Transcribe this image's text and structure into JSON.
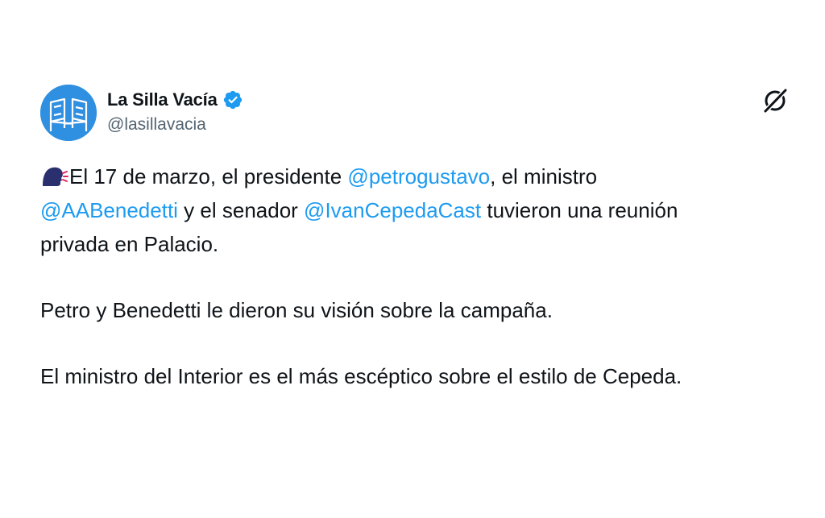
{
  "author": {
    "display_name": "La Silla Vacía",
    "handle": "@lasillavacia",
    "verified": true,
    "avatar_icon": "two-chairs-logo",
    "avatar_color": "#2f8fe0"
  },
  "header": {
    "grok_icon": "grok-icon"
  },
  "tweet": {
    "emoji": "speaking-head-emoji",
    "p1_t1": "El 17 de marzo, el presidente ",
    "p1_m1": "@petrogustavo",
    "p1_t2": ", el ministro",
    "p1_m2": "@AABenedetti",
    "p1_t3": " y el senador ",
    "p1_m3": "@IvanCepedaCast",
    "p1_t4": " tuvieron una reunión",
    "p1_t5": "privada en Palacio.",
    "p2": "Petro y Benedetti le dieron su visión sobre la campaña.",
    "p3": "El ministro del Interior es el más escéptico sobre el estilo de Cepeda."
  },
  "colors": {
    "text": "#0f1419",
    "secondary": "#536471",
    "link": "#1d9bf0",
    "verified": "#1d9bf0"
  }
}
